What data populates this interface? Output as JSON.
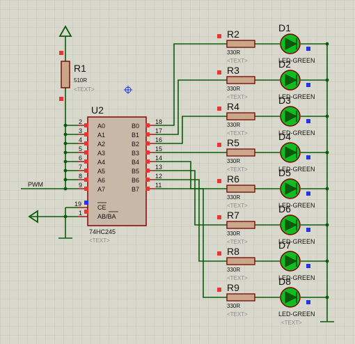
{
  "colors": {
    "background": "#d8d8cc",
    "grid": "#c6c6b8",
    "wire": "#0a5a0a",
    "chip_border": "#8b0000",
    "chip_fill": "#c8b8a8",
    "pin_marker": "#ee3333",
    "pin_blue": "#2233ee",
    "led_fill": "#11bb22",
    "led_ring": "#7a0000",
    "resistor_fill": "#c8a888",
    "label": "#111111",
    "text_placeholder": "#8a8a8a"
  },
  "r1": {
    "name": "R1",
    "value": "510R",
    "text": "<TEXT>"
  },
  "u2": {
    "name": "U2",
    "part": "74HC245",
    "text": "<TEXT>",
    "pins_a": [
      "A0",
      "A1",
      "A2",
      "A3",
      "A4",
      "A5",
      "A6",
      "A7"
    ],
    "pins_a_num": [
      "2",
      "3",
      "4",
      "5",
      "6",
      "7",
      "8",
      "9"
    ],
    "pins_b": [
      "B0",
      "B1",
      "B2",
      "B3",
      "B4",
      "B5",
      "B6",
      "B7"
    ],
    "pins_b_num": [
      "18",
      "17",
      "16",
      "15",
      "14",
      "13",
      "12",
      "11"
    ],
    "ce_label": "CE",
    "ce_num": "19",
    "dir_label": "AB/BA",
    "dir_num": "1"
  },
  "pwm_label": "PWM",
  "resistors": [
    {
      "name": "R2",
      "value": "330R",
      "text": "<TEXT>"
    },
    {
      "name": "R3",
      "value": "330R",
      "text": "<TEXT>"
    },
    {
      "name": "R4",
      "value": "330R",
      "text": "<TEXT>"
    },
    {
      "name": "R5",
      "value": "330R",
      "text": "<TEXT>"
    },
    {
      "name": "R6",
      "value": "330R",
      "text": "<TEXT>"
    },
    {
      "name": "R7",
      "value": "330R",
      "text": "<TEXT>"
    },
    {
      "name": "R8",
      "value": "330R",
      "text": "<TEXT>"
    },
    {
      "name": "R9",
      "value": "330R",
      "text": "<TEXT>"
    }
  ],
  "leds": [
    {
      "name": "D1",
      "value": "LED-GREEN",
      "text": "<TEXT>"
    },
    {
      "name": "D2",
      "value": "LED-GREEN",
      "text": "<TEXT>"
    },
    {
      "name": "D3",
      "value": "LED-GREEN",
      "text": "<TEXT>"
    },
    {
      "name": "D4",
      "value": "LED-GREEN",
      "text": "<TEXT>"
    },
    {
      "name": "D5",
      "value": "LED-GREEN",
      "text": "<TEXT>"
    },
    {
      "name": "D6",
      "value": "LED-GREEN",
      "text": "<TEXT>"
    },
    {
      "name": "D7",
      "value": "LED-GREEN",
      "text": "<TEXT>"
    },
    {
      "name": "D8",
      "value": "LED-GREEN",
      "text": "<TEXT>"
    }
  ]
}
